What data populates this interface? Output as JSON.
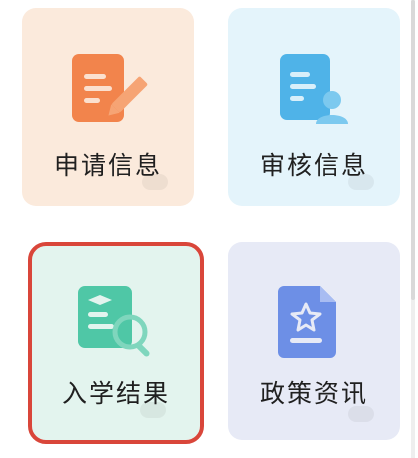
{
  "cards": [
    {
      "id": "apply",
      "label": "申请信息",
      "icon": "edit-document-icon",
      "color": "#f2844c"
    },
    {
      "id": "review",
      "label": "审核信息",
      "icon": "user-document-icon",
      "color": "#4fb3e8"
    },
    {
      "id": "result",
      "label": "入学结果",
      "icon": "search-document-icon",
      "color": "#4fc7a6",
      "highlighted": true
    },
    {
      "id": "policy",
      "label": "政策资讯",
      "icon": "star-document-icon",
      "color": "#6d8fe6"
    }
  ],
  "highlight_color": "#d9463a"
}
